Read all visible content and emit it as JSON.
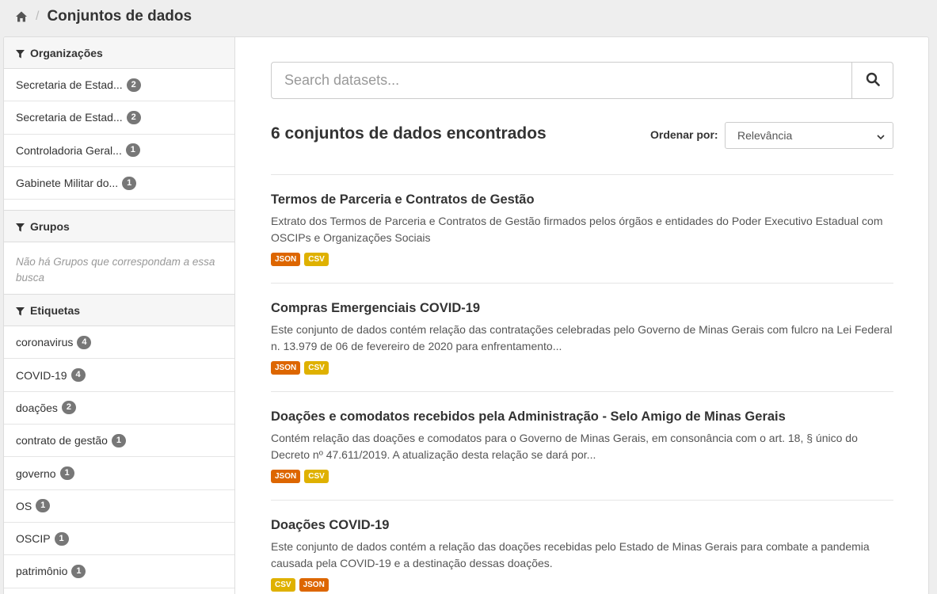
{
  "breadcrumb": {
    "home_icon": "home-icon",
    "separator": "/",
    "current": "Conjuntos de dados"
  },
  "sidebar": {
    "organizations": {
      "title": "Organizações",
      "items": [
        {
          "label": "Secretaria de Estad...",
          "count": "2"
        },
        {
          "label": "Secretaria de Estad...",
          "count": "2"
        },
        {
          "label": "Controladoria Geral...",
          "count": "1"
        },
        {
          "label": "Gabinete Militar do...",
          "count": "1"
        }
      ]
    },
    "groups": {
      "title": "Grupos",
      "empty": "Não há Grupos que correspondam a essa busca"
    },
    "tags": {
      "title": "Etiquetas",
      "items": [
        {
          "label": "coronavirus",
          "count": "4"
        },
        {
          "label": "COVID-19",
          "count": "4"
        },
        {
          "label": "doações",
          "count": "2"
        },
        {
          "label": "contrato de gestão",
          "count": "1"
        },
        {
          "label": "governo",
          "count": "1"
        },
        {
          "label": "OS",
          "count": "1"
        },
        {
          "label": "OSCIP",
          "count": "1"
        },
        {
          "label": "patrimônio",
          "count": "1"
        }
      ]
    }
  },
  "search": {
    "placeholder": "Search datasets...",
    "button_icon": "search-icon"
  },
  "results": {
    "count_text": "6 conjuntos de dados encontrados",
    "order_label": "Ordenar por:",
    "order_value": "Relevância",
    "datasets": [
      {
        "title": "Termos de Parceria e Contratos de Gestão",
        "notes": "Extrato dos Termos de Parceria e Contratos de Gestão firmados pelos órgãos e entidades do Poder Executivo Estadual com OSCIPs e Organizações Sociais",
        "formats": [
          "JSON",
          "CSV"
        ]
      },
      {
        "title": "Compras Emergenciais COVID-19",
        "notes": "Este conjunto de dados contém relação das contratações celebradas pelo Governo de Minas Gerais com fulcro na Lei Federal n. 13.979 de 06 de fevereiro de 2020 para enfrentamento...",
        "formats": [
          "JSON",
          "CSV"
        ]
      },
      {
        "title": "Doações e comodatos recebidos pela Administração - Selo Amigo de Minas Gerais",
        "notes": "Contém relação das doações e comodatos para o Governo de Minas Gerais, em consonância com o art. 18, § único do Decreto nº 47.611/2019. A atualização desta relação se dará por...",
        "formats": [
          "JSON",
          "CSV"
        ]
      },
      {
        "title": "Doações COVID-19",
        "notes": "Este conjunto de dados contém a relação das doações recebidas pelo Estado de Minas Gerais para combate a pandemia causada pela COVID-19 e a destinação dessas doações.",
        "formats": [
          "CSV",
          "JSON"
        ]
      }
    ]
  },
  "colors": {
    "json": "#dd6600",
    "csv": "#dfb100",
    "badge": "#777777"
  }
}
